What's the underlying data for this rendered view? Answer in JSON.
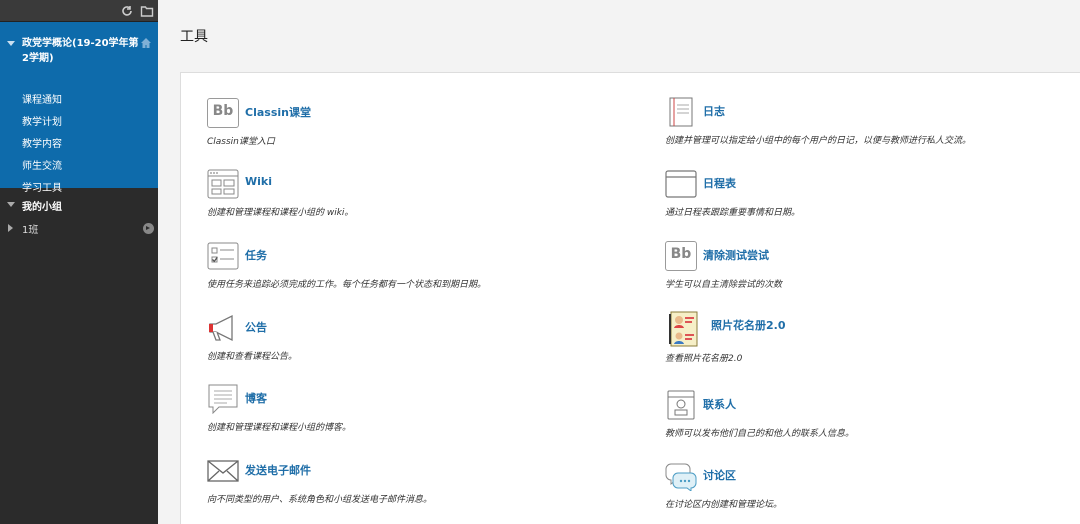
{
  "sidebar": {
    "course_title": "政党学概论(19-20学年第2学期)",
    "course_menu": [
      "课程通知",
      "教学计划",
      "教学内容",
      "师生交流",
      "学习工具"
    ],
    "groups_heading": "我的小组",
    "group_item": "1班",
    "icons": [
      "refresh-icon",
      "folder-icon",
      "home-icon"
    ]
  },
  "main": {
    "title": "工具",
    "tools_left": [
      {
        "name": "Classin课堂",
        "desc": "Classin课堂入口",
        "icon": "bb-logo-icon"
      },
      {
        "name": "Wiki",
        "desc": "创建和管理课程和课程小组的 wiki。",
        "icon": "wiki-icon"
      },
      {
        "name": "任务",
        "desc": "使用任务来追踪必须完成的工作。每个任务都有一个状态和到期日期。",
        "icon": "task-icon"
      },
      {
        "name": "公告",
        "desc": "创建和查看课程公告。",
        "icon": "megaphone-icon"
      },
      {
        "name": "博客",
        "desc": "创建和管理课程和课程小组的博客。",
        "icon": "blog-icon"
      },
      {
        "name": "发送电子邮件",
        "desc": "向不同类型的用户、系统角色和小组发送电子邮件消息。",
        "icon": "envelope-icon"
      }
    ],
    "tools_right": [
      {
        "name": "日志",
        "desc": "创建并管理可以指定给小组中的每个用户的日记，以便与教师进行私人交流。",
        "icon": "journal-icon"
      },
      {
        "name": "日程表",
        "desc": "通过日程表跟踪重要事情和日期。",
        "icon": "calendar-icon"
      },
      {
        "name": "清除测试尝试",
        "desc": "学生可以自主清除尝试的次数",
        "icon": "bb-logo-icon"
      },
      {
        "name": "照片花名册2.0",
        "desc": "查看照片花名册2.0",
        "icon": "photo-roster-icon"
      },
      {
        "name": "联系人",
        "desc": "教师可以发布他们自己的和他人的联系人信息。",
        "icon": "contacts-icon"
      },
      {
        "name": "讨论区",
        "desc": "在讨论区内创建和管理论坛。",
        "icon": "discussion-icon"
      }
    ]
  },
  "colors": {
    "sidebar_bg": "#2b2b2b",
    "course_block": "#0e6bab",
    "link": "#1f6ea8"
  }
}
